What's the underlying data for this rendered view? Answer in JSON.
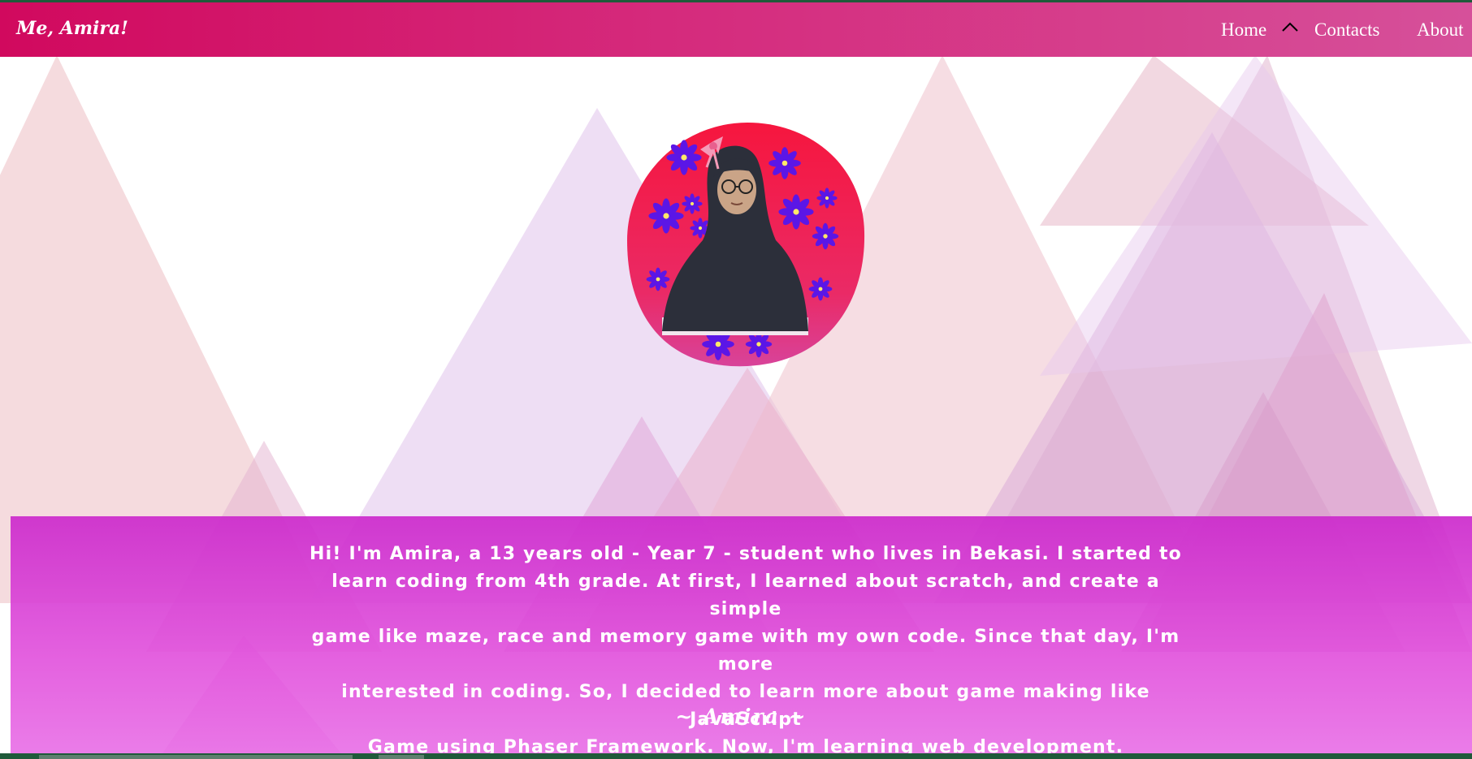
{
  "navbar": {
    "brand": "Me, Amira!",
    "items": [
      {
        "label": "Home"
      },
      {
        "label": "Contacts"
      },
      {
        "label": "About"
      }
    ]
  },
  "about": {
    "paragraph_lines": [
      "Hi! I'm Amira, a 13 years old - Year 7 - student who lives in Bekasi. I started to",
      "learn coding from 4th grade. At first, I learned about scratch, and create a simple",
      "game like maze, race and memory game with my own code. Since that day, I'm more",
      "interested in coding. So, I decided to learn more about game making like JavaScript",
      "Game using Phaser Framework. Now, I'm learning web development."
    ],
    "signature": "~ Amira ~"
  },
  "colors": {
    "navbar_start": "#d1095e",
    "navbar_end": "#d6509a",
    "section_bg": "#cc2acc",
    "avatar_bg": "#ee1c55",
    "flower": "#5b16e6"
  }
}
